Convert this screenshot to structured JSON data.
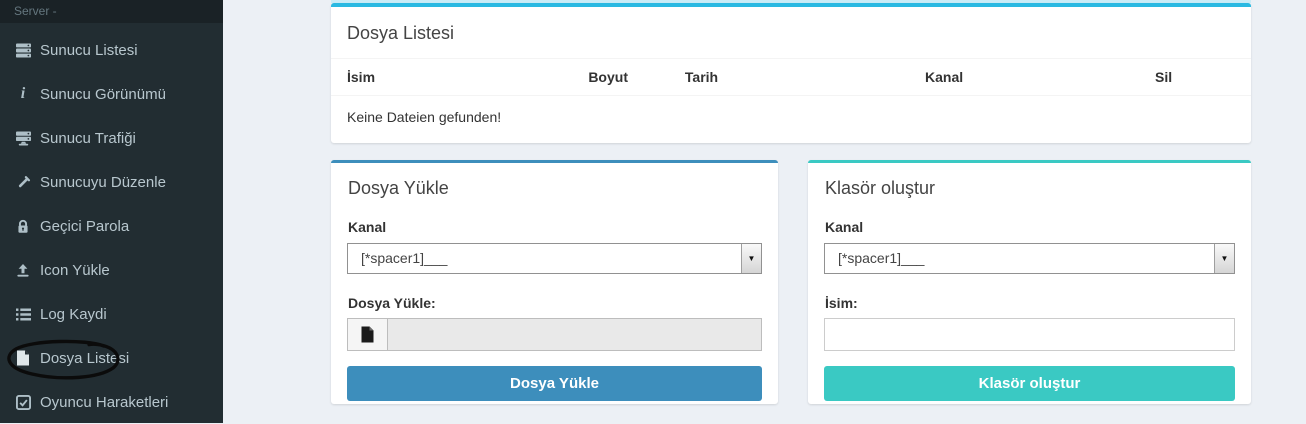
{
  "sidebar": {
    "header": "Server -",
    "items": [
      {
        "label": "Sunucu Listesi",
        "icon": "server-icon"
      },
      {
        "label": "Sunucu Görünümü",
        "icon": "info-icon"
      },
      {
        "label": "Sunucu Trafiği",
        "icon": "server-traffic-icon"
      },
      {
        "label": "Sunucuyu Düzenle",
        "icon": "wrench-icon"
      },
      {
        "label": "Geçici Parola",
        "icon": "lock-icon"
      },
      {
        "label": "Icon Yükle",
        "icon": "upload-icon"
      },
      {
        "label": "Log Kaydi",
        "icon": "list-icon"
      },
      {
        "label": "Dosya Listesi",
        "icon": "file-icon",
        "annotated": true
      },
      {
        "label": "Oyuncu Haraketleri",
        "icon": "check-square-icon"
      }
    ]
  },
  "annotation": {
    "shape": "hand-drawn-ellipse",
    "target": "Dosya Listesi",
    "color": "#0b0b0b"
  },
  "file_list_panel": {
    "title": "Dosya Listesi",
    "accent_color": "#29b9e2",
    "columns": [
      "İsim",
      "Boyut",
      "Tarih",
      "Kanal",
      "Sil"
    ],
    "empty_message": "Keine Dateien gefunden!"
  },
  "upload_panel": {
    "title": "Dosya Yükle",
    "accent_color": "#3d8ebc",
    "channel_label": "Kanal",
    "channel_value": "[*spacer1]___",
    "file_label": "Dosya Yükle:",
    "file_value": "",
    "button_label": "Dosya Yükle",
    "dropdown_arrow": "▼"
  },
  "folder_panel": {
    "title": "Klasör oluştur",
    "accent_color": "#3ac9c3",
    "channel_label": "Kanal",
    "channel_value": "[*spacer1]___",
    "name_label": "İsim:",
    "name_value": "",
    "button_label": "Klasör oluştur",
    "dropdown_arrow": "▼"
  }
}
